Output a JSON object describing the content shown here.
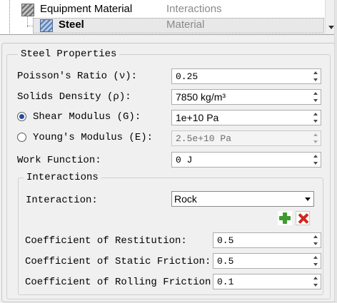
{
  "tree": {
    "rows": [
      {
        "label": "Equipment Material",
        "type": "Interactions"
      },
      {
        "label": "Steel",
        "type": "Material"
      }
    ]
  },
  "properties": {
    "group_title": "Steel Properties",
    "poisson": {
      "label": "Poisson's Ratio (ν):",
      "value": "0.25"
    },
    "density": {
      "label": "Solids Density (ρ):",
      "value": "7850 kg/m³"
    },
    "shear": {
      "label": "Shear Modulus (G):",
      "value": "1e+10 Pa",
      "selected": true
    },
    "young": {
      "label": "Young's Modulus (E):",
      "value": "2.5e+10 Pa",
      "selected": false
    },
    "work_function": {
      "label": "Work Function:",
      "value": "0 J"
    }
  },
  "interactions": {
    "group_title": "Interactions",
    "interaction_label": "Interaction:",
    "interaction_value": "Rock",
    "restitution": {
      "label": "Coefficient of Restitution:",
      "value": "0.5"
    },
    "static_friction": {
      "label": "Coefficient of Static Friction:",
      "value": "0.5"
    },
    "rolling_friction": {
      "label": "Coefficient of Rolling Friction:",
      "value": "0.1"
    }
  },
  "icons": {
    "add": "add-icon",
    "delete": "delete-icon",
    "material": "material-icon"
  },
  "colors": {
    "add_green": "#3f9a2f",
    "delete_red": "#d2261c",
    "radio_blue": "#1f4e9a",
    "selection": "#e8e8e8"
  }
}
